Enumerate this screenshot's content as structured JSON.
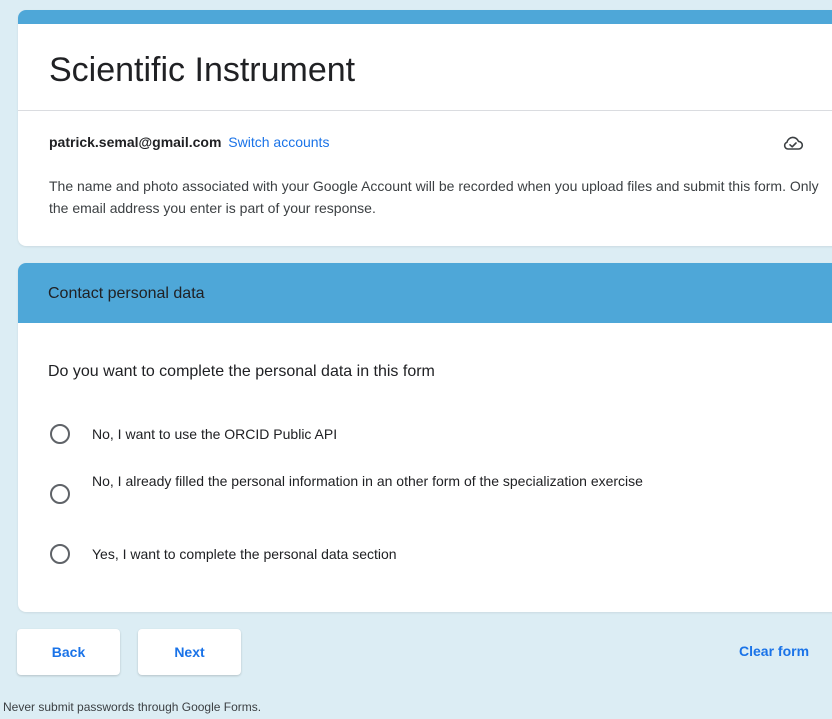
{
  "form": {
    "title": "Scientific Instrument",
    "accent_color": "#4ea7d8"
  },
  "account": {
    "email": "patrick.semal@gmail.com",
    "switch_label": "Switch accounts",
    "notice": "The name and photo associated with your Google Account will be recorded when you upload files and submit this form. Only the email address you enter is part of your response.",
    "status_icon": "cloud-check-icon"
  },
  "section": {
    "title": "Contact personal data",
    "question": "Do you want to complete the personal data in this form",
    "options": [
      {
        "label": "No, I want to use the ORCID Public API"
      },
      {
        "label": "No, I already filled the personal information in an other form of the specialization exercise"
      },
      {
        "label": "Yes, I want to complete the personal data section"
      }
    ]
  },
  "nav": {
    "back_label": "Back",
    "next_label": "Next",
    "clear_label": "Clear form"
  },
  "footer": {
    "note": "Never submit passwords through Google Forms."
  },
  "colors": {
    "background": "#dcedf4",
    "link": "#1a73e8",
    "section_header": "#4ea7d8"
  }
}
